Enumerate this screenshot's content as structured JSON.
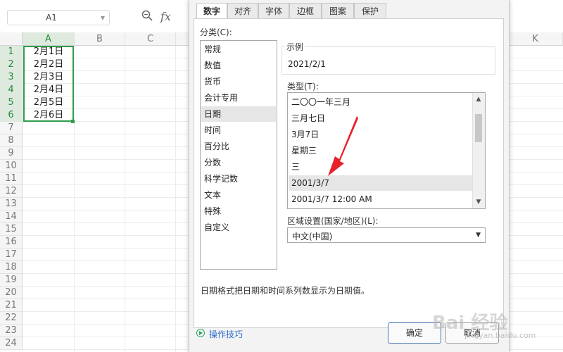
{
  "spreadsheet": {
    "name_box": "A1",
    "fx_label": "fx",
    "columns": [
      "A",
      "B",
      "C",
      "K"
    ],
    "rows": [
      "1",
      "2",
      "3",
      "4",
      "5",
      "6",
      "7",
      "8",
      "9",
      "10",
      "11",
      "12",
      "13",
      "14",
      "15",
      "16",
      "17",
      "18",
      "19",
      "20",
      "21",
      "22",
      "23",
      "24"
    ],
    "cells": [
      "2月1日",
      "2月2日",
      "2月3日",
      "2月4日",
      "2月5日",
      "2月6日"
    ]
  },
  "dialog": {
    "tabs": [
      "数字",
      "对齐",
      "字体",
      "边框",
      "图案",
      "保护"
    ],
    "category_label": "分类(C):",
    "categories": [
      "常规",
      "数值",
      "货币",
      "会计专用",
      "日期",
      "时间",
      "百分比",
      "分数",
      "科学记数",
      "文本",
      "特殊",
      "自定义"
    ],
    "selected_category": "日期",
    "sample_label": "示例",
    "sample_value": "2021/2/1",
    "type_label": "类型(T):",
    "types": [
      "二〇〇一年三月",
      "三月七日",
      "3月7日",
      "星期三",
      "三",
      "2001/3/7",
      "2001/3/7 12:00 AM"
    ],
    "selected_type": "2001/3/7",
    "locale_label": "区域设置(国家/地区)(L):",
    "locale_value": "中文(中国)",
    "description": "日期格式把日期和时间系列数显示为日期值。",
    "tips_link": "操作技巧",
    "ok_button": "确定",
    "cancel_button": "取消"
  },
  "watermark": {
    "brand": "Bai 经验",
    "url": "jingyan.baidu.com"
  },
  "colors": {
    "selection_green": "#2f9e4a",
    "annotation_red": "#e8202a",
    "link_blue": "#2a6ccc"
  }
}
